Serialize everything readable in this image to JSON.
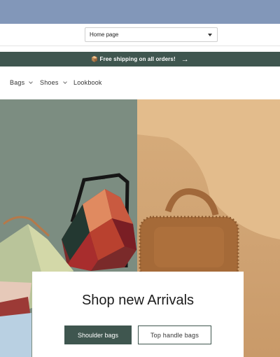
{
  "page_selector": {
    "value": "Home page"
  },
  "announcement": {
    "icon": "package-icon",
    "text": "📦 Free shipping on all orders!",
    "arrow": "→"
  },
  "nav": {
    "items": [
      {
        "label": "Bags",
        "has_dropdown": true
      },
      {
        "label": "Shoes",
        "has_dropdown": true
      },
      {
        "label": "Lookbook",
        "has_dropdown": false
      }
    ]
  },
  "hero": {
    "title": "Shop new Arrivals",
    "primary_button": "Shoulder bags",
    "secondary_button": "Top handle bags"
  },
  "colors": {
    "top_band": "#8297b9",
    "accent": "#3f564f",
    "hero_left_bg": "#7c8d81",
    "hero_right_bg": "#d7ad7c"
  }
}
